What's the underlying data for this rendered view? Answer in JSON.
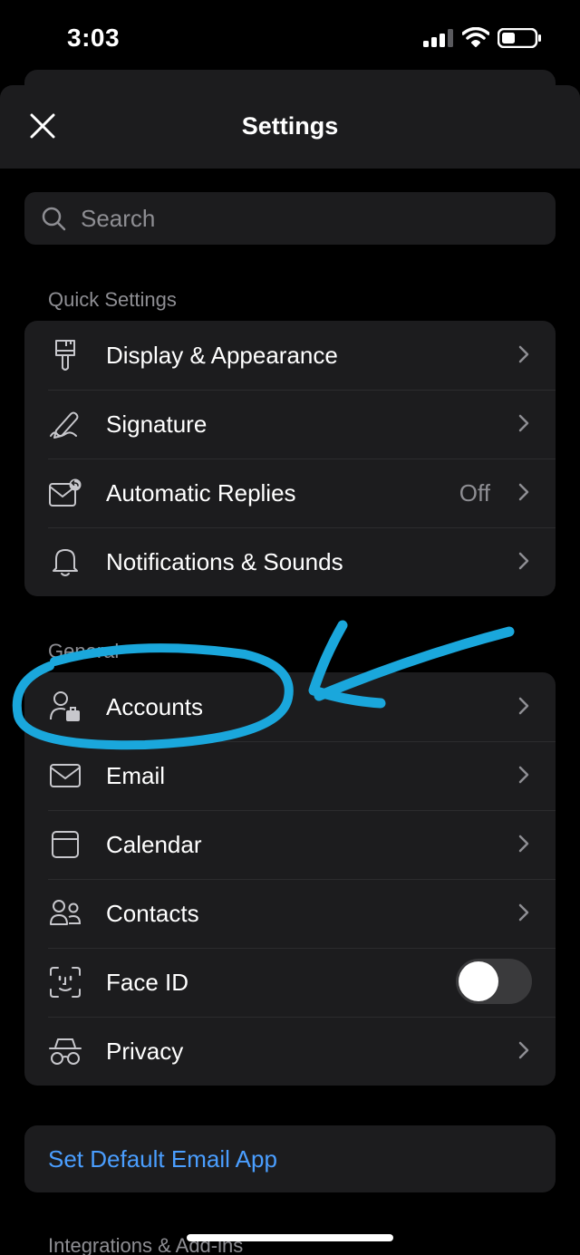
{
  "status_bar": {
    "time": "3:03"
  },
  "header": {
    "title": "Settings"
  },
  "search": {
    "placeholder": "Search"
  },
  "quick_settings": {
    "label": "Quick Settings",
    "items": [
      {
        "label": "Display & Appearance",
        "icon": "paint-brush-icon"
      },
      {
        "label": "Signature",
        "icon": "signature-pen-icon"
      },
      {
        "label": "Automatic Replies",
        "value": "Off",
        "icon": "mail-reply-icon"
      },
      {
        "label": "Notifications & Sounds",
        "icon": "bell-icon"
      }
    ]
  },
  "general": {
    "label": "General",
    "items": [
      {
        "label": "Accounts",
        "icon": "account-briefcase-icon"
      },
      {
        "label": "Email",
        "icon": "envelope-icon"
      },
      {
        "label": "Calendar",
        "icon": "calendar-icon"
      },
      {
        "label": "Contacts",
        "icon": "contacts-icon"
      },
      {
        "label": "Face ID",
        "icon": "face-id-icon",
        "toggle": false
      },
      {
        "label": "Privacy",
        "icon": "privacy-spy-icon"
      }
    ]
  },
  "default_app": {
    "label": "Set Default Email App"
  },
  "integrations": {
    "label": "Integrations & Add-ins"
  },
  "colors": {
    "background": "#000000",
    "card": "#1c1c1e",
    "link": "#4a9eff",
    "annotation": "#1aa7dc"
  }
}
